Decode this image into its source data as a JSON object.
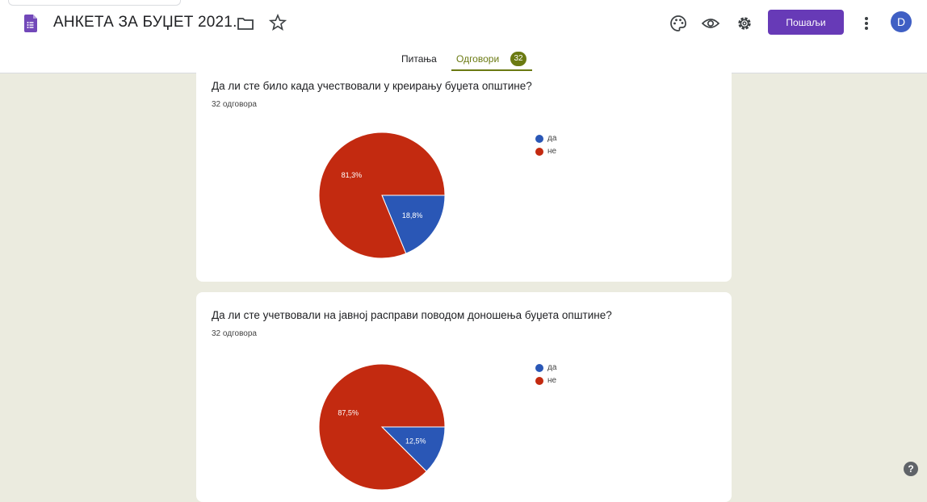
{
  "header": {
    "title": "АНКЕТА ЗА БУЏЕТ 2021.",
    "send_label": "Пошаљи",
    "avatar_letter": "D",
    "accent_color": "#673ab7"
  },
  "tabs": {
    "questions_label": "Питања",
    "responses_label": "Одговори",
    "responses_count": "32",
    "active_color": "#6b7a12"
  },
  "questions": [
    {
      "title": "Да ли сте било када учествовали у креирању буџета општине?",
      "count_text": "32 одговора",
      "legend": [
        "да",
        "не"
      ]
    },
    {
      "title": "Да ли сте учетвовали на јавној расправи поводом доношења буџета општине?",
      "count_text": "32 одговора",
      "legend": [
        "да",
        "не"
      ]
    }
  ],
  "chart_data": [
    {
      "type": "pie",
      "categories": [
        "да",
        "не"
      ],
      "values": [
        18.8,
        81.3
      ],
      "labels": [
        "18,8%",
        "81,3%"
      ],
      "colors": [
        "#2a57b6",
        "#c32a10"
      ],
      "legend_position": "top-right"
    },
    {
      "type": "pie",
      "categories": [
        "да",
        "не"
      ],
      "values": [
        12.5,
        87.5
      ],
      "labels": [
        "12,5%",
        "87,5%"
      ],
      "colors": [
        "#2a57b6",
        "#c32a10"
      ],
      "legend_position": "top-right"
    }
  ],
  "icons": [
    "forms-logo-icon",
    "folder-icon",
    "star-icon",
    "palette-icon",
    "eye-icon",
    "gear-icon",
    "more-vert-icon",
    "help-icon"
  ]
}
